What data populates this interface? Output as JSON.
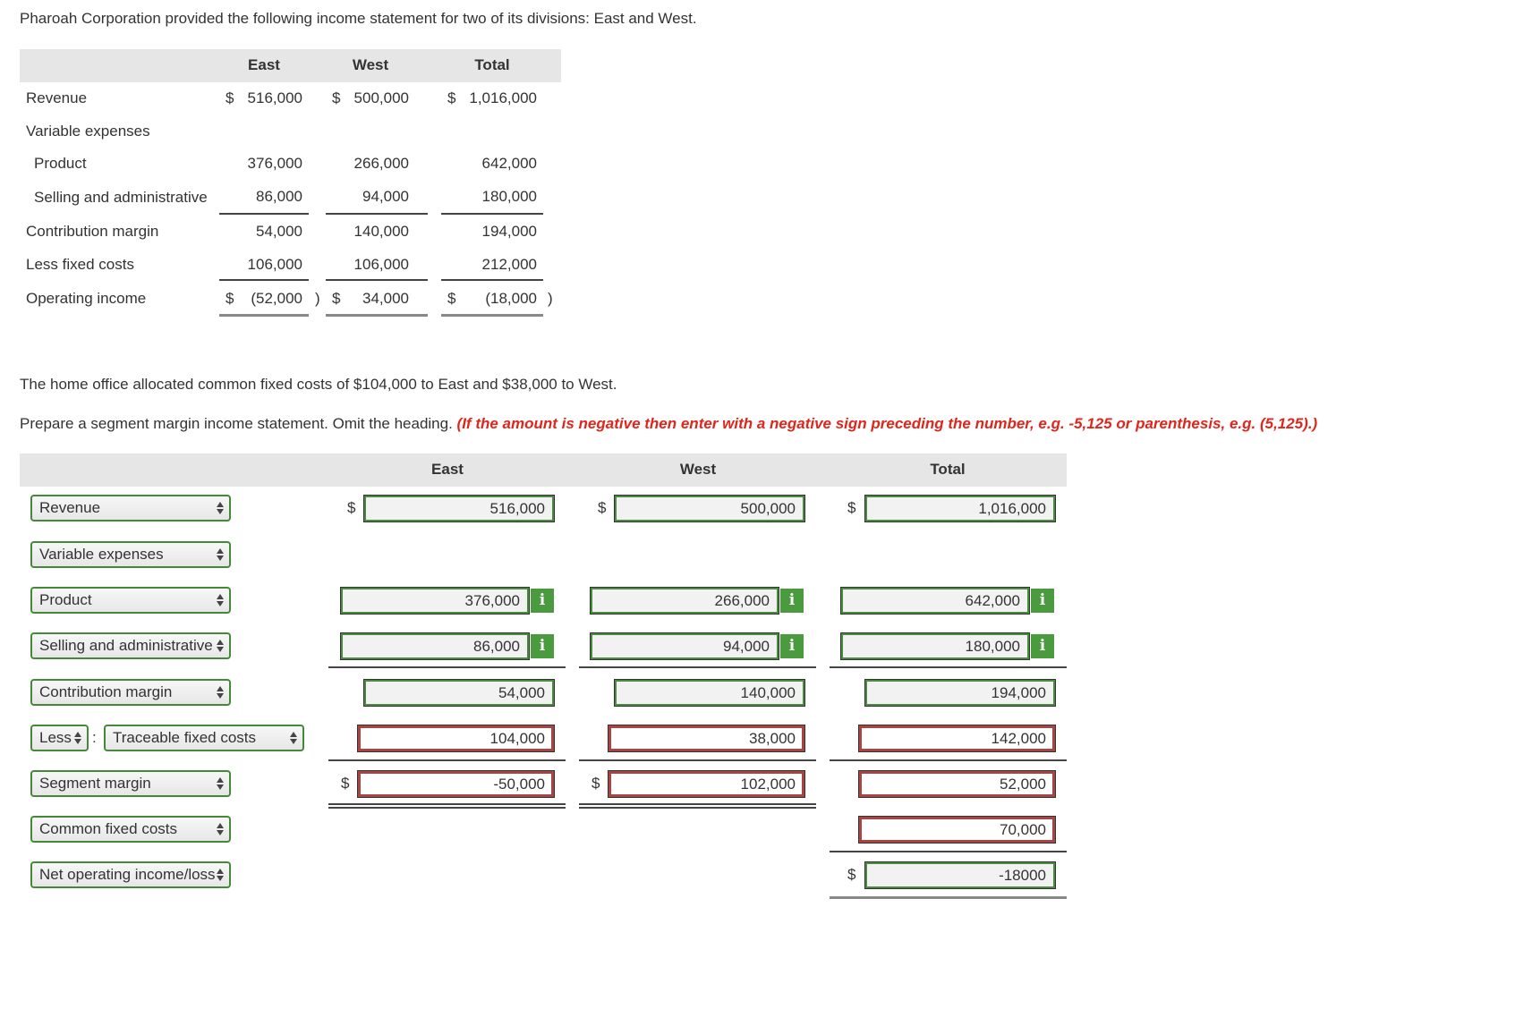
{
  "intro": "Pharoah Corporation provided the following income statement for two of its divisions: East and West.",
  "given": {
    "headers": {
      "east": "East",
      "west": "West",
      "total": "Total"
    },
    "rows": [
      {
        "label": "Revenue",
        "east": "516,000",
        "west": "500,000",
        "total": "1,016,000"
      },
      {
        "label": "Variable expenses"
      },
      {
        "label": "Product",
        "east": "376,000",
        "west": "266,000",
        "total": "642,000"
      },
      {
        "label": "Selling and administrative",
        "east": "86,000",
        "west": "94,000",
        "total": "180,000"
      },
      {
        "label": "Contribution margin",
        "east": "54,000",
        "west": "140,000",
        "total": "194,000"
      },
      {
        "label": "Less fixed costs",
        "east": "106,000",
        "west": "106,000",
        "total": "212,000"
      },
      {
        "label": "Operating income",
        "east": "(52,000",
        "west": "34,000",
        "total": "(18,000"
      }
    ],
    "dollar": "$",
    "paren": ")"
  },
  "allocation_text": "The home office allocated common fixed costs of $104,000 to East and $38,000 to West.",
  "instruction": "Prepare a segment margin income statement. Omit the heading.",
  "instruction_note": "(If the amount is negative then enter with a negative sign preceding the number, e.g. -5,125 or parenthesis, e.g. (5,125).)",
  "answer": {
    "headers": {
      "east": "East",
      "west": "West",
      "total": "Total"
    },
    "separator": ":",
    "rows": {
      "revenue": {
        "label": "Revenue",
        "east": "516,000",
        "west": "500,000",
        "total": "1,016,000"
      },
      "variable": {
        "label": "Variable expenses"
      },
      "product": {
        "label": "Product",
        "east": "376,000",
        "west": "266,000",
        "total": "642,000"
      },
      "selling": {
        "label": "Selling and administrative",
        "east": "86,000",
        "west": "94,000",
        "total": "180,000"
      },
      "cm": {
        "label": "Contribution margin",
        "east": "54,000",
        "west": "140,000",
        "total": "194,000"
      },
      "traceable": {
        "prefix": "Less",
        "label": "Traceable fixed costs",
        "east": "104,000",
        "west": "38,000",
        "total": "142,000"
      },
      "segment": {
        "label": "Segment margin",
        "east": "-50,000",
        "west": "102,000",
        "total": "52,000"
      },
      "common": {
        "label": "Common fixed costs",
        "total": "70,000"
      },
      "net": {
        "label": "Net operating income/loss",
        "total": "-18000"
      }
    },
    "info_icon": "i"
  }
}
